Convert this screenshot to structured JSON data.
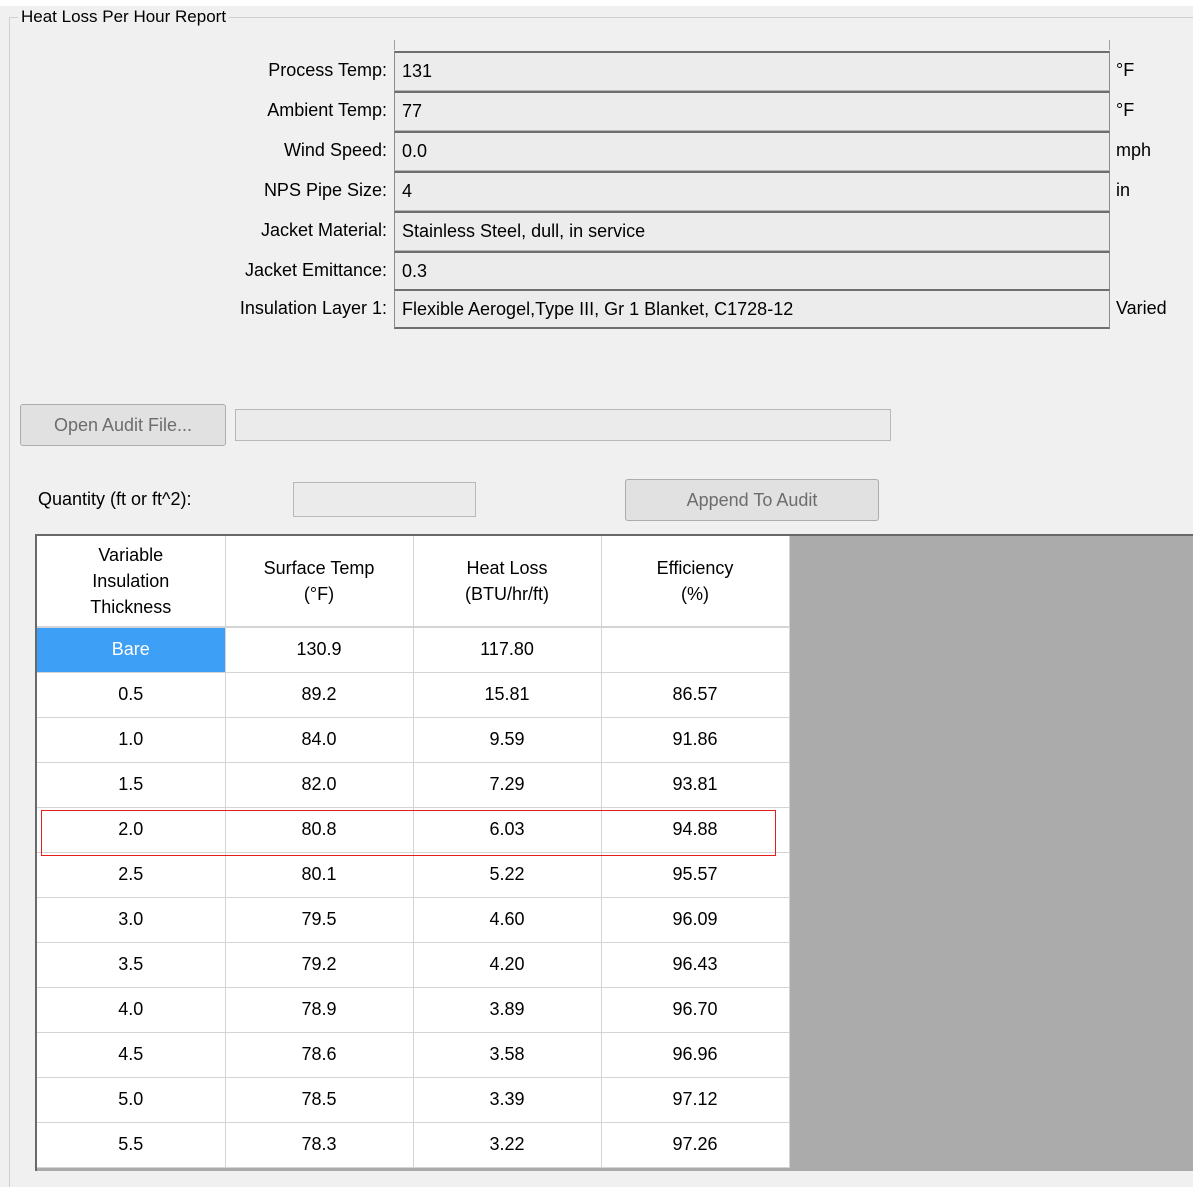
{
  "report": {
    "title": "Heat Loss Per Hour Report"
  },
  "fields": [
    {
      "label": "Process Temp:",
      "value": "131",
      "unit": "°F"
    },
    {
      "label": "Ambient Temp:",
      "value": "77",
      "unit": "°F"
    },
    {
      "label": "Wind Speed:",
      "value": "0.0",
      "unit": "mph"
    },
    {
      "label": "NPS Pipe Size:",
      "value": "4",
      "unit": "in"
    },
    {
      "label": "Jacket Material:",
      "value": "Stainless Steel, dull, in service",
      "unit": ""
    },
    {
      "label": "Jacket Emittance:",
      "value": "0.3",
      "unit": ""
    },
    {
      "label": "Insulation Layer 1:",
      "value": "Flexible Aerogel,Type III, Gr 1 Blanket, C1728-12",
      "unit": "Varied"
    }
  ],
  "audit": {
    "open_button_label": "Open Audit File...",
    "file_path": "",
    "quantity_label": "Quantity (ft or ft^2):",
    "quantity_value": "",
    "append_button_label": "Append To Audit"
  },
  "table": {
    "columns": [
      "Variable\nInsulation\nThickness",
      "Surface Temp\n(°F)",
      "Heat Loss\n(BTU/hr/ft)",
      "Efficiency\n(%)"
    ],
    "rows": [
      [
        "Bare",
        "130.9",
        "117.80",
        ""
      ],
      [
        "0.5",
        "89.2",
        "15.81",
        "86.57"
      ],
      [
        "1.0",
        "84.0",
        "9.59",
        "91.86"
      ],
      [
        "1.5",
        "82.0",
        "7.29",
        "93.81"
      ],
      [
        "2.0",
        "80.8",
        "6.03",
        "94.88"
      ],
      [
        "2.5",
        "80.1",
        "5.22",
        "95.57"
      ],
      [
        "3.0",
        "79.5",
        "4.60",
        "96.09"
      ],
      [
        "3.5",
        "79.2",
        "4.20",
        "96.43"
      ],
      [
        "4.0",
        "78.9",
        "3.89",
        "96.70"
      ],
      [
        "4.5",
        "78.6",
        "3.58",
        "96.96"
      ],
      [
        "5.0",
        "78.5",
        "3.39",
        "97.12"
      ],
      [
        "5.5",
        "78.3",
        "3.22",
        "97.26"
      ]
    ],
    "selected_row": 0,
    "highlighted_row": 4
  },
  "colors": {
    "selection": "#3d9ff5",
    "highlight_border": "#e41e1e",
    "grid_background": "#ababab"
  }
}
